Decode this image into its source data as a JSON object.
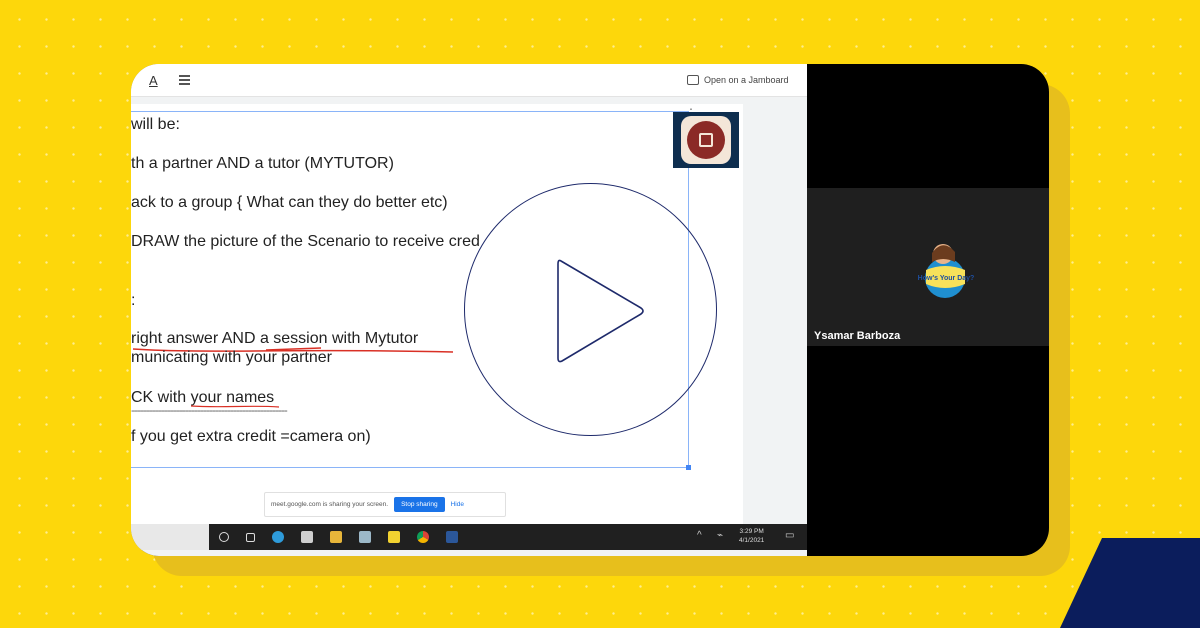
{
  "slides": {
    "toolbar": {
      "text_tool": "A",
      "open_jamboard": "Open on a Jamboard"
    },
    "lines": [
      "will be:",
      "th a partner AND a tutor (MYTUTOR)",
      "ack to a group { What can they do better etc)",
      "DRAW the picture of the Scenario to receive cred",
      ":",
      "right answer AND a session with Mytutor",
      "municating with your partner",
      "CK with your names",
      "----------------------------------------------------",
      "f you get extra credit =camera on)"
    ],
    "kebab": "⋮"
  },
  "share_bar": {
    "message": "meet.google.com is sharing your screen.",
    "stop_label": "Stop sharing",
    "hide_label": "Hide"
  },
  "taskbar": {
    "time": "3:29 PM",
    "date": "4/1/2021"
  },
  "participant": {
    "name": "Ysamar Barboza",
    "avatar_text": "How's Your Day?"
  },
  "colors": {
    "background": "#FDD70B",
    "shadow": "#E7BF1C",
    "navy": "#0B1D5C",
    "play_ring": "#1E2A6B"
  },
  "icons": [
    "play-icon",
    "jamboard-icon",
    "kebab-icon",
    "windows-taskbar-icons"
  ]
}
